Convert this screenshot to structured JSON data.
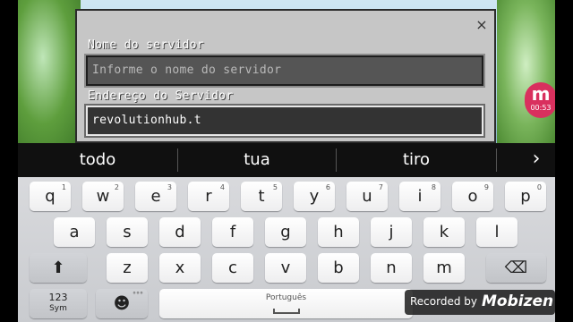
{
  "dialog": {
    "close_glyph": "×",
    "server_name_label": "Nome do servidor",
    "server_name_placeholder": "Informe o nome do servidor",
    "server_address_label": "Endereço do Servidor",
    "server_address_value": "revolutionhub.t"
  },
  "recorder_badge": {
    "logo": "m",
    "time": "00:53"
  },
  "suggestions": [
    "todo",
    "tua",
    "tiro"
  ],
  "suggestion_next_glyph": "›",
  "keyboard": {
    "row1": [
      {
        "key": "q",
        "sub": "1"
      },
      {
        "key": "w",
        "sub": "2"
      },
      {
        "key": "e",
        "sub": "3"
      },
      {
        "key": "r",
        "sub": "4"
      },
      {
        "key": "t",
        "sub": "5"
      },
      {
        "key": "y",
        "sub": "6"
      },
      {
        "key": "u",
        "sub": "7"
      },
      {
        "key": "i",
        "sub": "8"
      },
      {
        "key": "o",
        "sub": "9"
      },
      {
        "key": "p",
        "sub": "0"
      }
    ],
    "row2": [
      "a",
      "s",
      "d",
      "f",
      "g",
      "h",
      "j",
      "k",
      "l"
    ],
    "row3": [
      "z",
      "x",
      "c",
      "v",
      "b",
      "n",
      "m"
    ],
    "shift_glyph": "⬆",
    "backspace_glyph": "⌫",
    "symbols_label": "123",
    "symbols_sub": "Sym",
    "emoji_glyph": "☻",
    "emoji_sub": "°°°",
    "space_language": "Português"
  },
  "watermark": {
    "prefix": "Recorded by",
    "brand": "Mobizen"
  },
  "colors": {
    "badge": "#d9305e",
    "keyboard_bg": "#d4d6d9",
    "suggestion_bar": "#101010"
  }
}
